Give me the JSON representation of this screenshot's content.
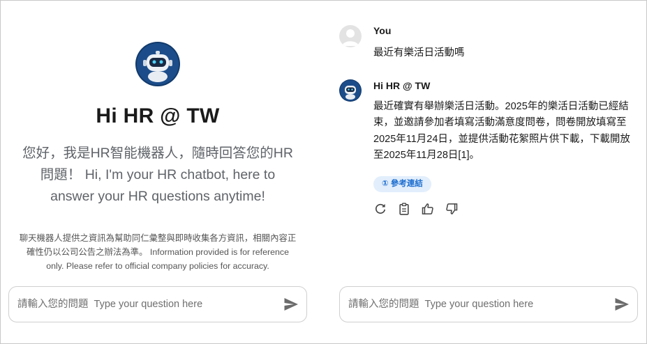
{
  "welcome": {
    "title": "Hi HR @ TW",
    "subtitle": "您好，我是HR智能機器人，隨時回答您的HR問題！ Hi, I'm your HR chatbot, here to answer your HR questions anytime!",
    "disclaimer": "聊天機器人提供之資訊為幫助同仁彙整與即時收集各方資訊，相關內容正確性仍以公司公告之辦法為準。 Information provided is for reference only. Please refer to official company policies for accuracy."
  },
  "input": {
    "placeholder": "請輸入您的問題  Type your question here",
    "send_icon": "send-icon"
  },
  "conversation": {
    "user": {
      "name": "You",
      "message": "最近有樂活日活動嗎"
    },
    "bot": {
      "name": "Hi HR @ TW",
      "message": "最近確實有舉辦樂活日活動。2025年的樂活日活動已經結束，並邀請參加者填寫活動滿意度問卷，問卷開放填寫至2025年11月24日，並提供活動花絮照片供下載，下載開放至2025年11月28日[1]。",
      "reference_chip": "① 參考連結"
    },
    "actions": [
      "refresh-icon",
      "clipboard-icon",
      "thumbs-up-icon",
      "thumbs-down-icon"
    ]
  },
  "colors": {
    "accent": "#1f6fd0",
    "chip_bg": "#e2eefc",
    "bot_avatar_bg": "#123a6b"
  }
}
